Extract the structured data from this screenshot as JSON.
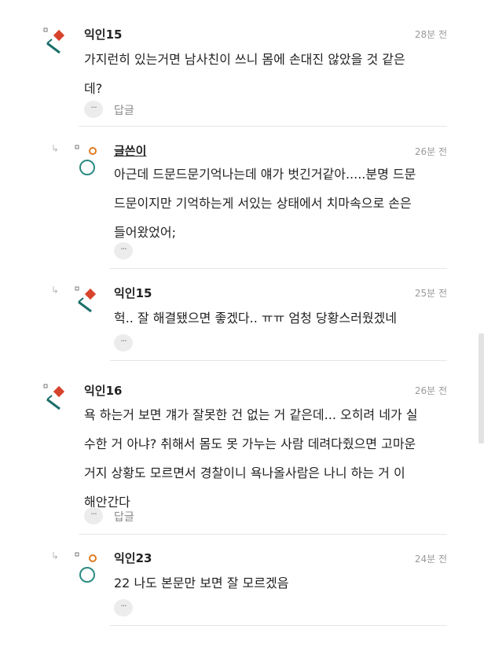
{
  "comments": [
    {
      "name": "익인15",
      "time": "28분 전",
      "text": "가지런히 있는거면 남사친이 쓰니 몸에 손대진 않았을 것 같은\n데?",
      "more": "···",
      "reply": "답글"
    },
    {
      "name": "글쓴이",
      "time": "26분 전",
      "text": "아근데 드문드문기억나는데 얘가 벗긴거같아.....분명 드문\n드문이지만 기억하는게 서있는 상태에서 치마속으로 손은\n들어왔었어;",
      "more": "···"
    },
    {
      "name": "익인15",
      "time": "25분 전",
      "text": "헉.. 잘 해결됐으면 좋겠다.. ㅠㅠ 엄청 당황스러웠겠네",
      "more": "···"
    },
    {
      "name": "익인16",
      "time": "26분 전",
      "text": "욕 하는거 보면 걔가 잘못한 건 없는 거 같은데... 오히려 네가 실\n수한 거 아냐? 취해서 몸도 못 가누는 사람 데려다줬으면 고마운\n거지 상황도 모르면서 경찰이니 욕나올사람은 나니 하는 거 이\n해안간다",
      "more": "···",
      "reply": "답글"
    },
    {
      "name": "익인23",
      "time": "24분 전",
      "text": "22 나도 본문만 보면 잘 모르겠음",
      "more": "···"
    }
  ],
  "icons": {
    "anon_avatar": "diamond-avatar-icon",
    "author_avatar": "circle-avatar-icon",
    "reply_arrow": "reply-arrow-icon"
  },
  "colors": {
    "avatar_red": "#d8432c",
    "avatar_teal": "#1a6f6a",
    "author_orange": "#e07b1f",
    "author_teal": "#2b8a83"
  }
}
